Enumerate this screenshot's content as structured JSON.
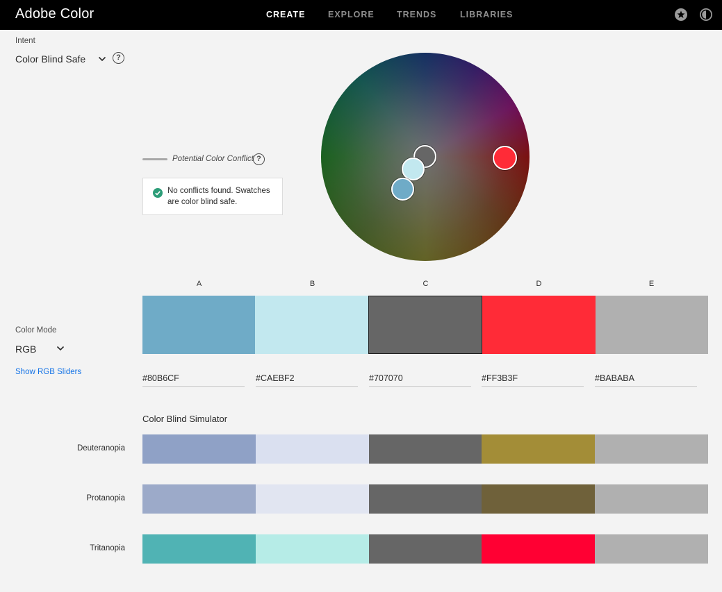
{
  "app": {
    "title": "Adobe Color",
    "nav": [
      "CREATE",
      "EXPLORE",
      "TRENDS",
      "LIBRARIES"
    ],
    "active_nav": "CREATE",
    "icons": [
      "favorites-star-icon",
      "theme-toggle-icon"
    ]
  },
  "intent": {
    "label": "Intent",
    "value": "Color Blind Safe"
  },
  "conflict": {
    "legend": "Potential Color Conflict",
    "status": "No conflicts found. Swatches are color blind safe.",
    "status_color": "#2d9d78"
  },
  "color_mode": {
    "label": "Color Mode",
    "value": "RGB",
    "link": "Show RGB Sliders"
  },
  "swatches": [
    {
      "letter": "A",
      "hex": "#80B6CF",
      "color": "#6FABC7"
    },
    {
      "letter": "B",
      "hex": "#CAEBF2",
      "color": "#C2E8EF"
    },
    {
      "letter": "C",
      "hex": "#707070",
      "color": "#666666",
      "selected": true
    },
    {
      "letter": "D",
      "hex": "#FF3B3F",
      "color": "#FF2B37"
    },
    {
      "letter": "E",
      "hex": "#BABABA",
      "color": "#B0B0B0"
    }
  ],
  "simulator": {
    "title": "Color Blind Simulator",
    "rows": [
      {
        "label": "Deuteranopia",
        "colors": [
          "#8FA1C6",
          "#DAE0F0",
          "#666666",
          "#A38D37",
          "#B0B0B0"
        ]
      },
      {
        "label": "Protanopia",
        "colors": [
          "#9CAAC9",
          "#E1E5F1",
          "#666666",
          "#6F613A",
          "#B0B0B0"
        ]
      },
      {
        "label": "Tritanopia",
        "colors": [
          "#50B3B4",
          "#B6ECE7",
          "#666666",
          "#FF0033",
          "#B0B0B0"
        ]
      }
    ]
  }
}
